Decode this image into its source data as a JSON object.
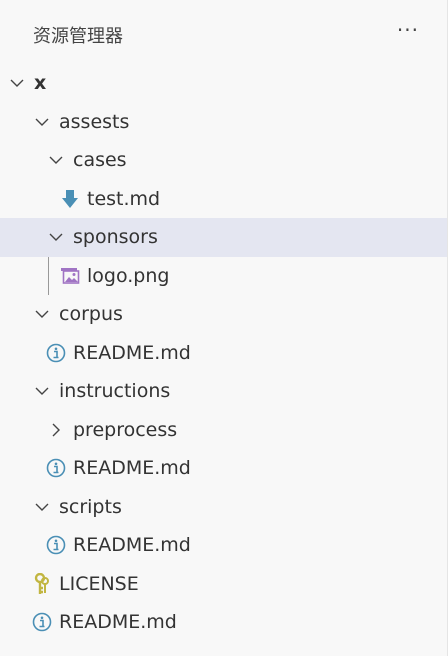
{
  "header": {
    "title": "资源管理器",
    "more_icon": "ellipsis-icon"
  },
  "tree": [
    {
      "label": "x",
      "depth": 0,
      "type": "folder",
      "expanded": true,
      "bold": true
    },
    {
      "label": "assests",
      "depth": 1,
      "type": "folder",
      "expanded": true
    },
    {
      "label": "cases",
      "depth": 2,
      "type": "folder",
      "expanded": true
    },
    {
      "label": "test.md",
      "depth": 3,
      "type": "file",
      "icon": "download-arrow-icon"
    },
    {
      "label": "sponsors",
      "depth": 2,
      "type": "folder",
      "expanded": true,
      "selected": true
    },
    {
      "label": "logo.png",
      "depth": 3,
      "type": "file",
      "icon": "image-icon",
      "guide": true
    },
    {
      "label": "corpus",
      "depth": 1,
      "type": "folder",
      "expanded": true
    },
    {
      "label": "README.md",
      "depth": 2,
      "type": "file",
      "icon": "info-icon"
    },
    {
      "label": "instructions",
      "depth": 1,
      "type": "folder",
      "expanded": true
    },
    {
      "label": "preprocess",
      "depth": 2,
      "type": "folder",
      "expanded": false
    },
    {
      "label": "README.md",
      "depth": 2,
      "type": "file",
      "icon": "info-icon"
    },
    {
      "label": "scripts",
      "depth": 1,
      "type": "folder",
      "expanded": true
    },
    {
      "label": "README.md",
      "depth": 2,
      "type": "file",
      "icon": "info-icon"
    },
    {
      "label": "LICENSE",
      "depth": 1,
      "type": "file",
      "icon": "key-icon"
    },
    {
      "label": "README.md",
      "depth": 1,
      "type": "file",
      "icon": "info-icon"
    }
  ],
  "colors": {
    "selected": "#e4e6f1",
    "info": "#4a8fb5",
    "md": "#4a8fb5",
    "image": "#a074c4",
    "key": "#c2b642"
  }
}
